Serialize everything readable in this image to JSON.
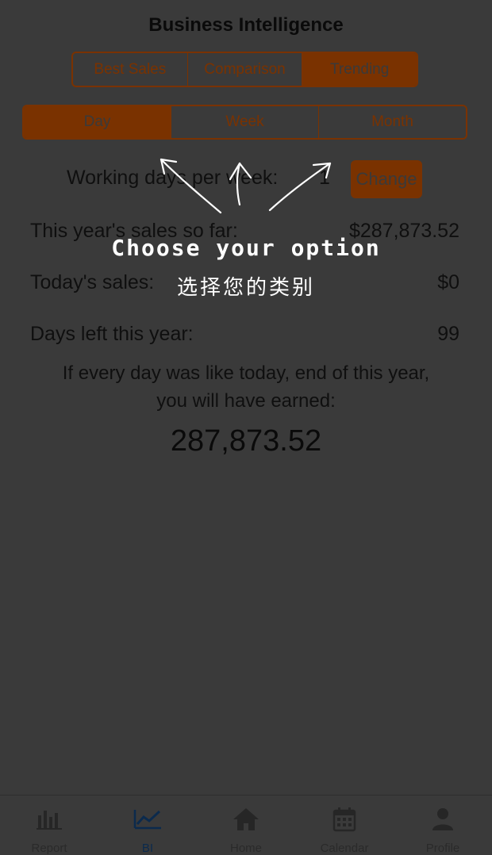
{
  "header": {
    "title": "Business Intelligence"
  },
  "top_tabs": [
    {
      "label": "Best Sales",
      "active": false
    },
    {
      "label": "Comparison",
      "active": false
    },
    {
      "label": "Trending",
      "active": true
    }
  ],
  "period_tabs": [
    {
      "label": "Day",
      "active": true
    },
    {
      "label": "Week",
      "active": false
    },
    {
      "label": "Month",
      "active": false
    }
  ],
  "working_days": {
    "label": "Working days per week:",
    "value": "1",
    "change_label": "Change"
  },
  "stats": [
    {
      "label": "This year's sales so far:",
      "value": "$287,873.52"
    },
    {
      "label": "Today's sales:",
      "value": "$0"
    },
    {
      "label": "Days left this year:",
      "value": "99"
    }
  ],
  "projection": {
    "line1": "If every day was like today, end of this year,",
    "line2": "you will have earned:",
    "value": "287,873.52"
  },
  "overlay": {
    "english": "Choose your option",
    "chinese": "选择您的类别"
  },
  "tabbar": [
    {
      "label": "Report",
      "icon": "bar-chart-icon",
      "active": false
    },
    {
      "label": "BI",
      "icon": "line-chart-icon",
      "active": true
    },
    {
      "label": "Home",
      "icon": "home-icon",
      "active": false
    },
    {
      "label": "Calendar",
      "icon": "calendar-icon",
      "active": false
    },
    {
      "label": "Profile",
      "icon": "person-icon",
      "active": false
    }
  ],
  "colors": {
    "accent": "#7a3200",
    "background": "#3a3a3a",
    "active_tab": "#0b2a4d",
    "overlay_text": "#ffffff"
  }
}
